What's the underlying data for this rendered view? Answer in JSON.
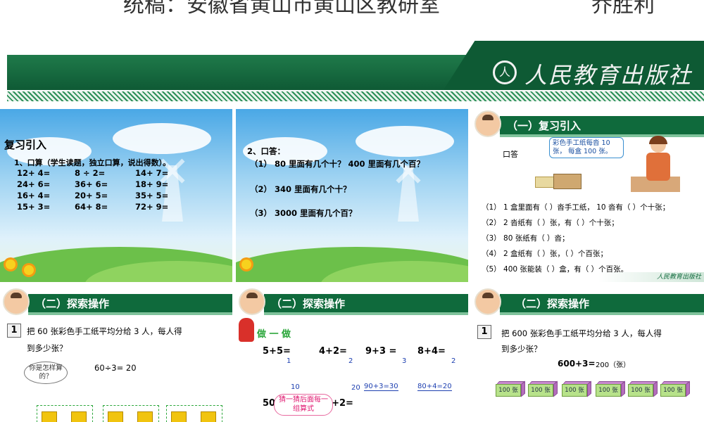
{
  "top_credit": {
    "left": "统稿：安徽省黄山市黄山区教研室",
    "right": "乔胜利"
  },
  "banner": {
    "publisher": "人民教育出版社",
    "logo_glyph": "人"
  },
  "slide1": {
    "title": "复习引入",
    "instruction": "1、口算（学生读题，独立口算，说出得数）。",
    "rows": [
      [
        "12+ 4=",
        "8 ÷ 2=",
        "14+ 7="
      ],
      [
        "24+ 6=",
        "36+ 6=",
        "18+ 9="
      ],
      [
        "16+ 4=",
        "20+ 5=",
        "35+ 5="
      ],
      [
        "15+ 3=",
        "64+ 8=",
        "72+ 9="
      ]
    ]
  },
  "slide2": {
    "title": "2、口答：",
    "q1": "（1） 80 里面有几个十？ 400 里面有几个百？",
    "q2": "（2） 340 里面有几个十？",
    "q3": "（3） 3000 里面有几个百？"
  },
  "slide3": {
    "header": "（一）复习引入",
    "label": "口答",
    "bubble": "彩色手工纸每沓 10 张， 每盒 100 张。",
    "questions": [
      "（1） 1 盒里面有（   ）沓手工纸， 10 沓有（   ）个十张；",
      "（2） 2 沓纸有（      ）张，有（      ）个十张；",
      "（3） 80 张纸有（      ）沓；",
      "（4） 2 盒纸有（      ）张，（       ）个百张；",
      "（5） 400 张能装（      ）盒，有（      ）个百张。"
    ],
    "mini_logo": "人民教育出版社"
  },
  "slide4": {
    "header": "（二）探索操作",
    "num": "1",
    "problem_line1": "把 60  张彩色手工纸平均分给 3  人，每人得",
    "problem_line2": "到多少张？",
    "think": "你是怎样算的？",
    "equation": "60÷3= 20"
  },
  "slide5": {
    "header": "（二）探索操作",
    "doit": "做 一 做",
    "row1": [
      "5+5=",
      "4+2=",
      "9+3 =",
      "8+4="
    ],
    "row1_ans": [
      "1",
      "2",
      "3",
      "2"
    ],
    "row2_ans": [
      "10",
      "20",
      "90+3=30",
      "80+4=20"
    ],
    "row3": [
      "50+5=",
      "40+2="
    ],
    "bubble": "猜一猜后面每一组算式"
  },
  "slide6": {
    "header": "（二）探索操作",
    "num": "1",
    "problem_line1": "把 600  张彩色手工纸平均分给 3  人，每人得",
    "problem_line2": "到多少张？",
    "equation": "600+3=",
    "answer": "200（张）",
    "stack_label": "100 张"
  }
}
